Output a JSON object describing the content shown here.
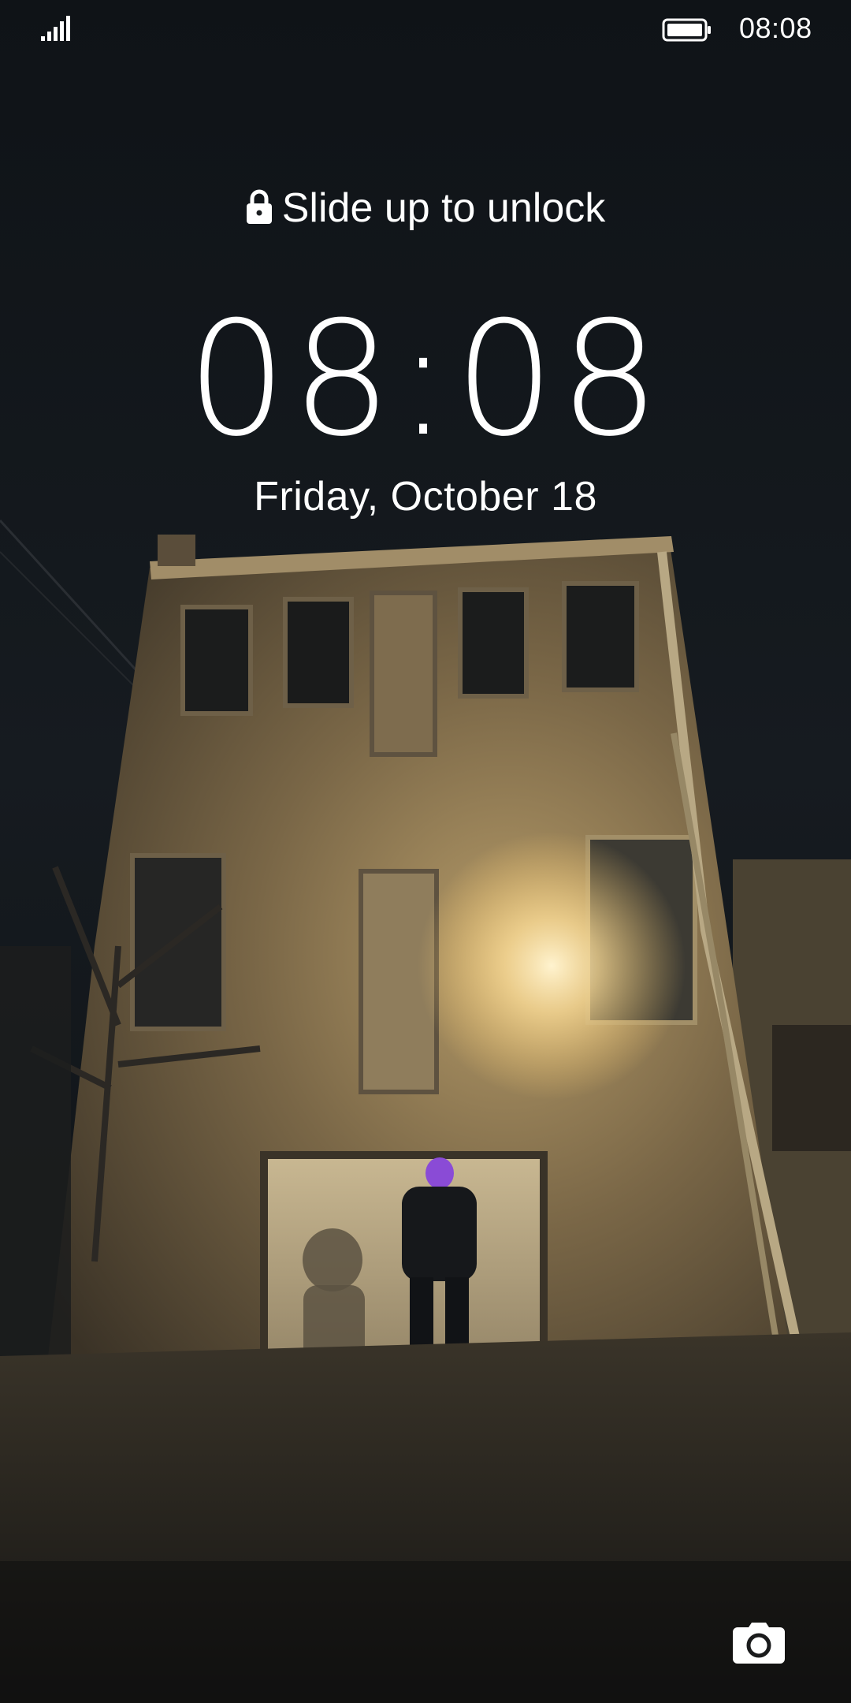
{
  "status_bar": {
    "signal_icon": "cellular-signal-icon",
    "battery_icon": "battery-full-icon",
    "time": "08:08"
  },
  "lock_screen": {
    "unlock_hint": "Slide up to unlock",
    "lock_icon": "lock-icon",
    "clock": "08:08",
    "date": "Friday, October 18"
  },
  "shortcuts": {
    "camera_icon": "camera-icon"
  },
  "colors": {
    "text": "#ffffff",
    "sky": "#12161b",
    "wall": "#8a7650",
    "lamp_glow": "#ffe6a8"
  }
}
